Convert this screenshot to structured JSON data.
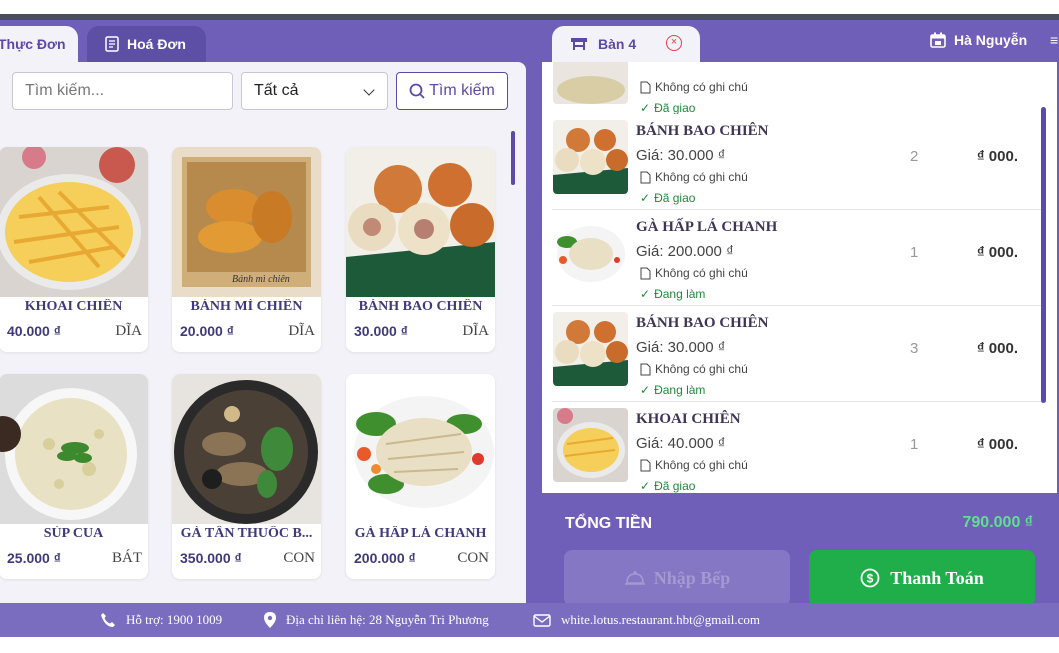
{
  "tabs": {
    "menu": "Thực Đơn",
    "invoice": "Hoá Đơn",
    "table": "Bàn 4"
  },
  "user": {
    "name": "Hà Nguyễn"
  },
  "search": {
    "placeholder": "Tìm kiếm...",
    "filter_value": "Tất cả",
    "button": "Tìm kiếm"
  },
  "menu_items": [
    {
      "name": "KHOAI CHIÊN",
      "price": "40.000 ₫",
      "unit": "DĨA"
    },
    {
      "name": "BÁNH MÌ CHIÊN",
      "price": "20.000 ₫",
      "unit": "DĨA"
    },
    {
      "name": "BÁNH BAO CHIÊN",
      "price": "30.000 ₫",
      "unit": "DĨA"
    },
    {
      "name": "SÚP CUA",
      "price": "25.000 ₫",
      "unit": "BÁT"
    },
    {
      "name": "GÀ TẦN THUỐC B...",
      "price": "350.000 ₫",
      "unit": "CON"
    },
    {
      "name": "GÀ HẤP LÁ CHANH",
      "price": "200.000 ₫",
      "unit": "CON"
    }
  ],
  "orders": [
    {
      "name": "",
      "price": "",
      "note": "Không có ghi chú",
      "status": "Đã giao",
      "qty": "",
      "total": ""
    },
    {
      "name": "BÁNH BAO CHIÊN",
      "price": "Giá: 30.000 ₫",
      "note": "Không có ghi chú",
      "status": "Đã giao",
      "qty": "2",
      "total": ".000 ₫"
    },
    {
      "name": "GÀ HẤP LÁ CHANH",
      "price": "Giá: 200.000 ₫",
      "note": "Không có ghi chú",
      "status": "Đang làm",
      "qty": "1",
      "total": ".000 ₫"
    },
    {
      "name": "BÁNH BAO CHIÊN",
      "price": "Giá: 30.000 ₫",
      "note": "Không có ghi chú",
      "status": "Đang làm",
      "qty": "3",
      "total": ".000 ₫"
    },
    {
      "name": "KHOAI CHIÊN",
      "price": "Giá: 40.000 ₫",
      "note": "Không có ghi chú",
      "status": "Đã giao",
      "qty": "1",
      "total": ".000 ₫"
    }
  ],
  "summary": {
    "label": "TỔNG TIỀN",
    "value": "790.000 ₫"
  },
  "actions": {
    "kitchen": "Nhập Bếp",
    "pay": "Thanh Toán"
  },
  "footer": {
    "support": "Hỗ trợ: 1900 1009",
    "address": "Địa chỉ liên hệ: 28 Nguyễn Tri Phương",
    "email": "white.lotus.restaurant.hbt@gmail.com"
  },
  "colors": {
    "accent": "#6f5fb8",
    "pay": "#1fae4a",
    "status": "#22883a",
    "total": "#5fe08f"
  }
}
